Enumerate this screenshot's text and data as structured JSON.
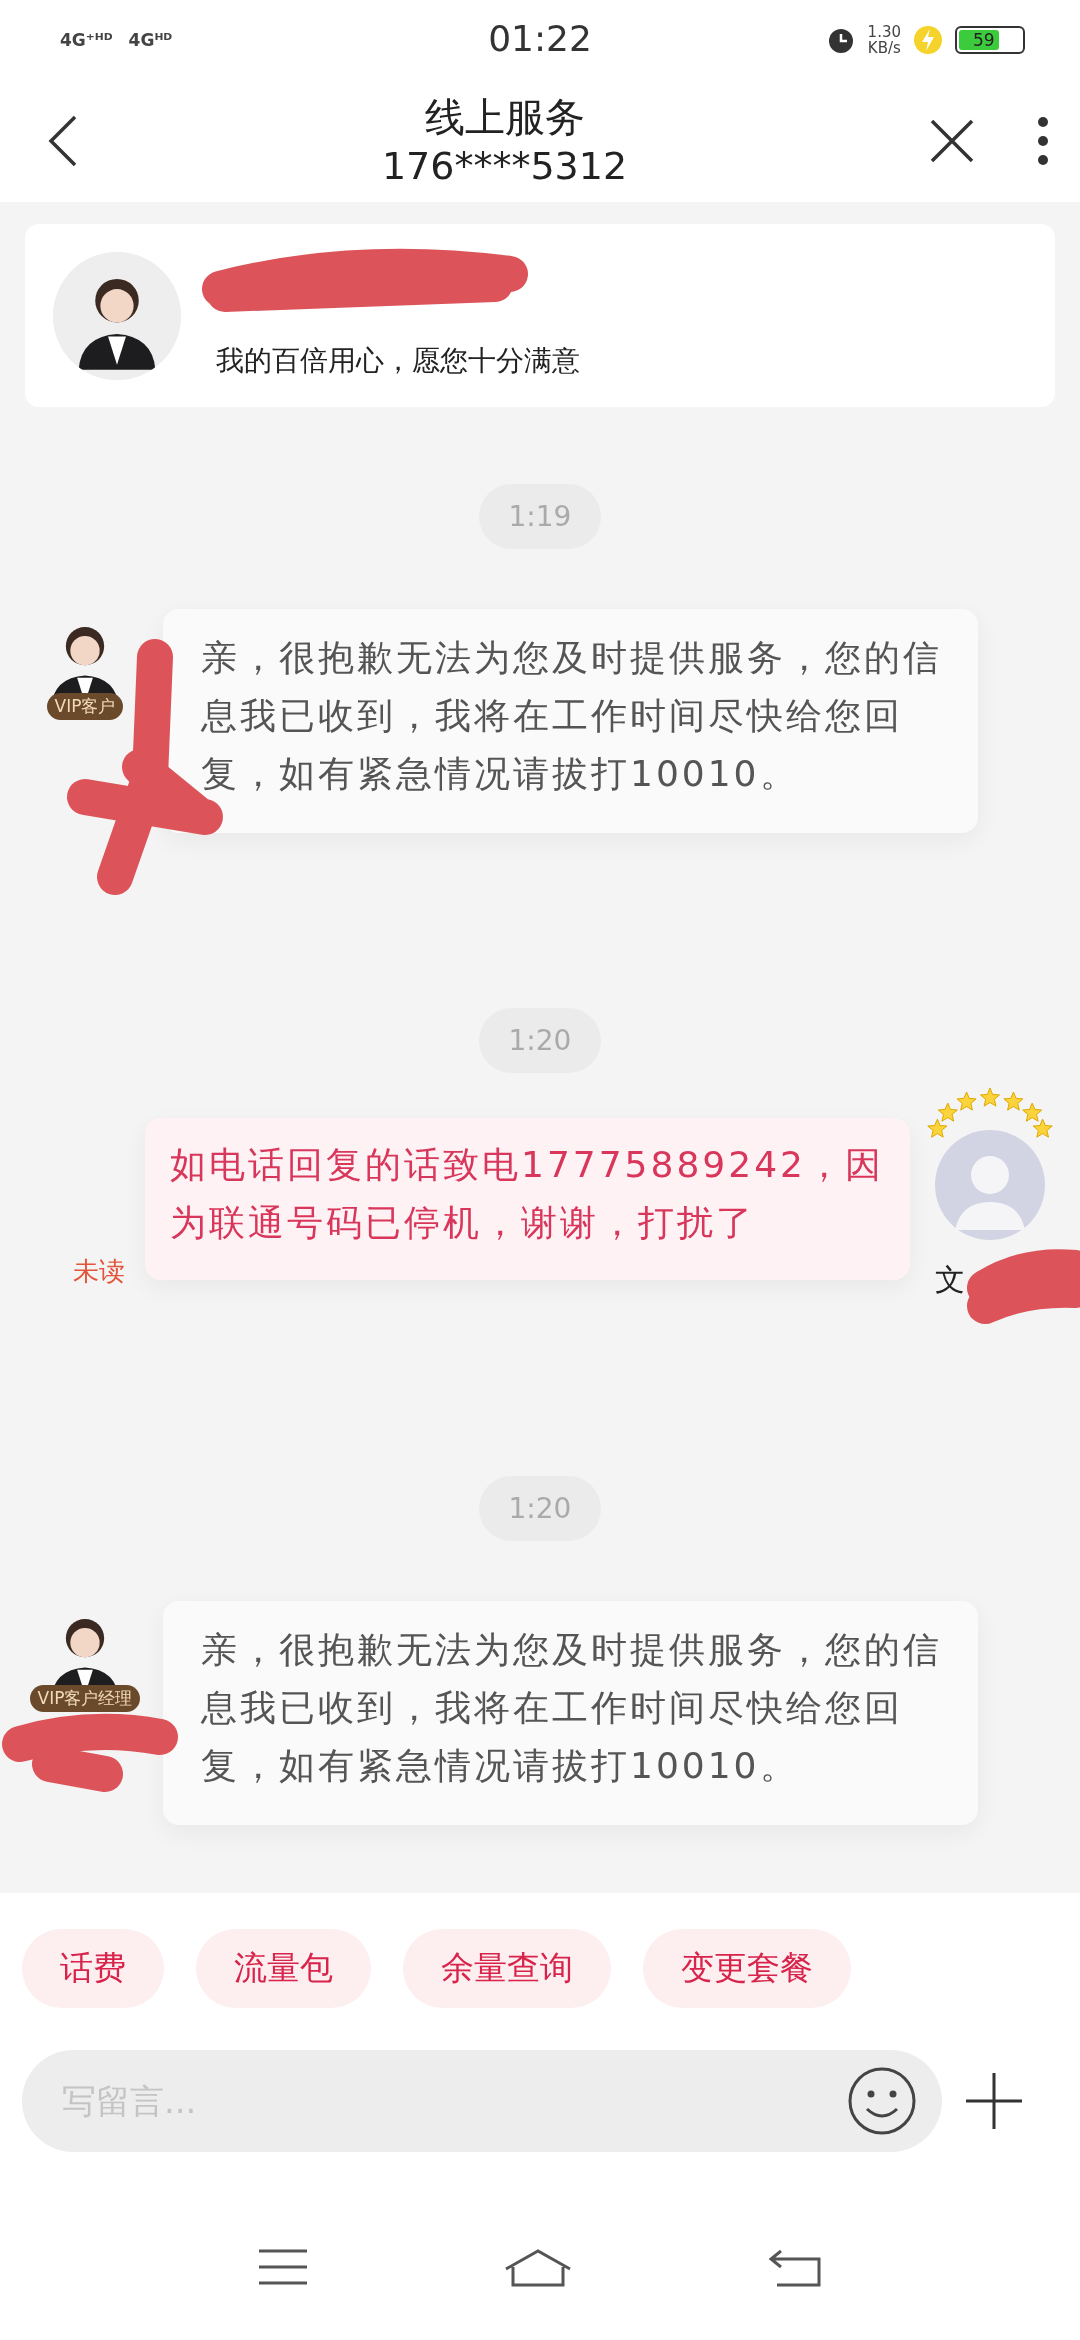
{
  "status_bar": {
    "network_1": "4G⁺ᴴᴰ",
    "network_2": "4Gᴴᴰ",
    "time": "01:22",
    "speed": "1.30",
    "speed_unit": "KB/s",
    "battery": "59"
  },
  "nav": {
    "title": "线上服务",
    "subtitle": "176****5312"
  },
  "agent_card": {
    "slogan": "我的百倍用心，愿您十分满意"
  },
  "messages": [
    {
      "kind": "time",
      "text": "1:19"
    },
    {
      "kind": "agent",
      "badge": "VIP客户",
      "text": "亲，很抱歉无法为您及时提供服务，您的信息我已收到，我将在工作时间尽快给您回复，如有紧急情况请拔打10010。"
    },
    {
      "kind": "time",
      "text": "1:20"
    },
    {
      "kind": "user",
      "text": "如电话回复的话致电17775889242，因为联通号码已停机，谢谢，打扰了",
      "read_status": "未读",
      "name": "文"
    },
    {
      "kind": "time",
      "text": "1:20"
    },
    {
      "kind": "agent",
      "badge": "VIP客户经理",
      "text": "亲，很抱歉无法为您及时提供服务，您的信息我已收到，我将在工作时间尽快给您回复，如有紧急情况请拔打10010。"
    }
  ],
  "quick_replies": [
    "话费",
    "流量包",
    "余量查询",
    "变更套餐"
  ],
  "input": {
    "placeholder": "写留言..."
  }
}
